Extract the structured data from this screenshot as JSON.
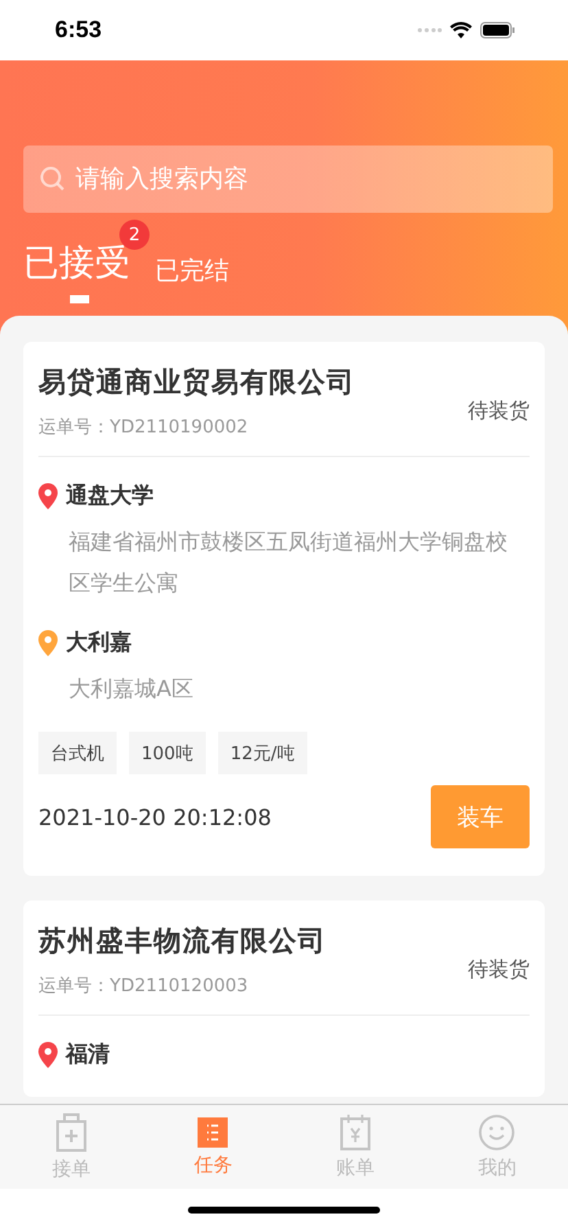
{
  "status_bar": {
    "time": "6:53"
  },
  "search": {
    "placeholder": "请输入搜索内容"
  },
  "tabs": [
    {
      "label": "已接受",
      "selected": true,
      "badge": "2"
    },
    {
      "label": "已完结",
      "selected": false
    }
  ],
  "orders": [
    {
      "company": "易贷通商业贸易有限公司",
      "waybill": "运单号：YD2110190002",
      "status": "待装货",
      "stops": [
        {
          "kind": "origin",
          "name": "通盘大学",
          "address": "福建省福州市鼓楼区五凤街道福州大学铜盘校区学生公寓"
        },
        {
          "kind": "destination",
          "name": "大利嘉",
          "address": "大利嘉城A区"
        }
      ],
      "tags": [
        "台式机",
        "100吨",
        "12元/吨"
      ],
      "time": "2021-10-20 20:12:08",
      "action": "装车"
    },
    {
      "company": "苏州盛丰物流有限公司",
      "waybill": "运单号：YD2110120003",
      "status": "待装货",
      "stops": [
        {
          "kind": "origin",
          "name": "福清"
        }
      ]
    }
  ],
  "nav": [
    {
      "kind": "receive",
      "label": "接单",
      "selected": false
    },
    {
      "kind": "tasks",
      "label": "任务",
      "selected": true
    },
    {
      "kind": "bills",
      "label": "账单",
      "selected": false
    },
    {
      "kind": "me",
      "label": "我的",
      "selected": false
    }
  ]
}
